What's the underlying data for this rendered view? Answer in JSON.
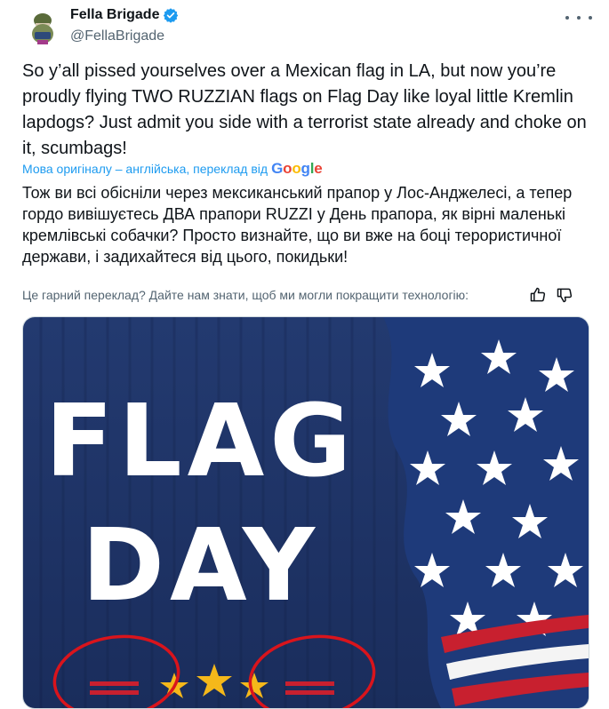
{
  "author": {
    "display_name": "Fella Brigade",
    "handle": "@FellaBrigade",
    "verified": true
  },
  "icons": {
    "avatar": "avatar-image",
    "verified": "verified-badge-icon",
    "more": "more-options-icon",
    "thumbs_up": "thumbs-up-icon",
    "thumbs_down": "thumbs-down-icon"
  },
  "tweet": {
    "text": "So y’all pissed yourselves over a Mexican flag in LA, but now you’re proudly flying TWO RUZZIAN flags on Flag Day like loyal little Kremlin lapdogs? Just admit you side with a terrorist state already and choke on it, scumbags!",
    "translation_label": "Мова оригіналу – англійська, переклад від",
    "translation_provider": "Google",
    "translated_text": "Тож ви всі обісніли через мексиканський прапор у Лос-Анджелесі, а тепер гордо вивішуєтесь ДВА прапори RUZZI у День прапора, як вірні маленькі кремлівські собачки? Просто визнайте, що ви вже на боці терористичної держави, і задихайтеся від цього, покидьки!",
    "feedback_prompt": "Це гарний переклад? Дайте нам знати, щоб ми могли покращити технологію:"
  },
  "media": {
    "headline_line1": "FLAG",
    "headline_line2": "DAY"
  },
  "colors": {
    "text_primary": "#0f1419",
    "text_secondary": "#536471",
    "link_blue": "#1d9bf0",
    "verified_blue": "#1d9bf0",
    "image_navy": "#1e3264",
    "flag_red": "#c8202f",
    "annotation_red": "#d9141c",
    "star_gold": "#f5b81a"
  }
}
